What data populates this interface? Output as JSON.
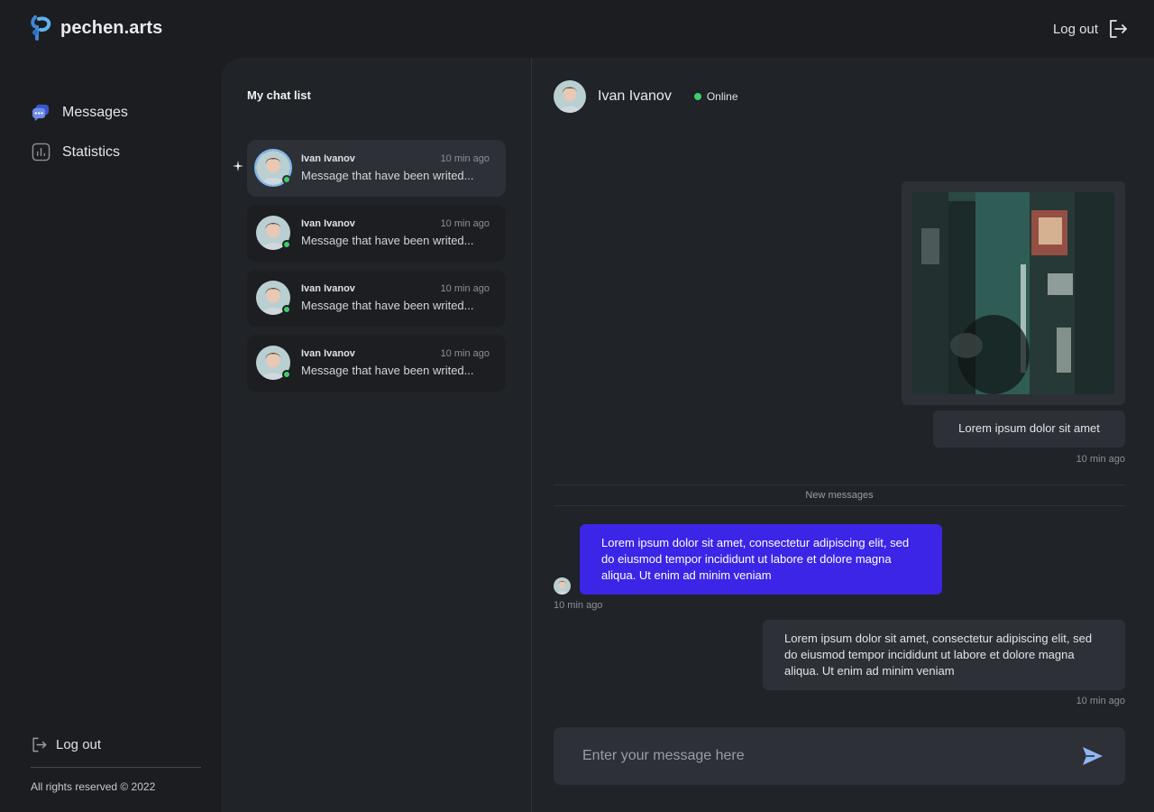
{
  "brand": {
    "name": "pechen.arts"
  },
  "header": {
    "logout_label": "Log out",
    "logout_icon": "logout-icon"
  },
  "sidebar": {
    "items": [
      {
        "label": "Messages",
        "icon": "messages-icon"
      },
      {
        "label": "Statistics",
        "icon": "statistics-icon"
      }
    ],
    "logout_label": "Log out",
    "copyright": "All rights reserved © 2022"
  },
  "chat_list": {
    "title": "My chat list",
    "items": [
      {
        "name": "Ivan Ivanov",
        "time": "10 min ago",
        "message": "Message that have been writed...",
        "active": true,
        "online": true
      },
      {
        "name": "Ivan Ivanov",
        "time": "10 min ago",
        "message": "Message that have been writed...",
        "active": false,
        "online": true
      },
      {
        "name": "Ivan Ivanov",
        "time": "10 min ago",
        "message": "Message that have been writed...",
        "active": false,
        "online": true
      },
      {
        "name": "Ivan Ivanov",
        "time": "10 min ago",
        "message": "Message that have been writed...",
        "active": false,
        "online": true
      }
    ]
  },
  "conversation": {
    "contact_name": "Ivan Ivanov",
    "status": "Online",
    "messages": [
      {
        "type": "image",
        "from": "me"
      },
      {
        "type": "text",
        "from": "me",
        "text": "Lorem ipsum dolor sit amet",
        "time": "10 min ago"
      },
      {
        "type": "text",
        "from": "contact",
        "text": "Lorem ipsum dolor sit amet, consectetur adipiscing elit, sed do eiusmod tempor incididunt ut labore et dolore magna aliqua. Ut enim ad minim veniam",
        "time": "10 min ago"
      },
      {
        "type": "text",
        "from": "me",
        "text": "Lorem ipsum dolor sit amet, consectetur adipiscing elit, sed do eiusmod tempor incididunt ut labore et dolore magna aliqua. Ut enim ad minim veniam",
        "time": "10 min ago"
      }
    ],
    "separator_label": "New messages",
    "composer": {
      "placeholder": "Enter your message here",
      "send_icon": "send-icon"
    }
  },
  "colors": {
    "background": "#1b1d20",
    "panel": "#202327",
    "accent": "#3b25e6",
    "online": "#3ccf6a",
    "bubble": "#2d3036"
  }
}
